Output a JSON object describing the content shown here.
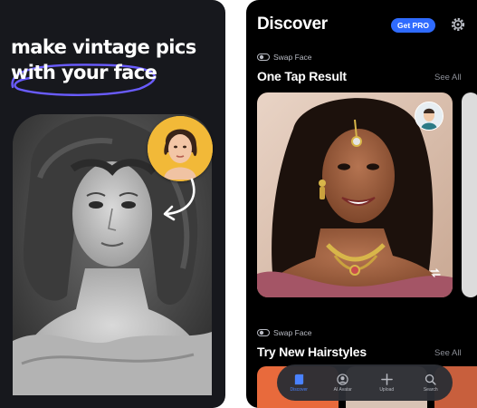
{
  "promo": {
    "headline_line1": "make vintage pics",
    "headline_line2": "with your face",
    "accent_color": "#6a5cff",
    "photo_style": "black-and-white vintage portrait",
    "face_bubble_color": "#f2b938",
    "icons": [
      "face-swap-arrow-icon"
    ]
  },
  "app": {
    "title": "Discover",
    "pro_badge": "Get PRO",
    "settings_icon": "gear-icon",
    "accent_color": "#2f6bff",
    "sections": [
      {
        "kicker": "Swap Face",
        "kicker_icon": "swap-face-icon",
        "title": "One Tap Result",
        "see_all": "See All"
      },
      {
        "kicker": "Swap Face",
        "kicker_icon": "swap-face-icon",
        "title": "Try New Hairstyles",
        "see_all": "See All"
      }
    ],
    "tabs": [
      {
        "label": "Discover",
        "icon": "discover-icon",
        "active": true
      },
      {
        "label": "AI Avatar",
        "icon": "avatar-icon",
        "active": false
      },
      {
        "label": "Upload",
        "icon": "plus-icon",
        "active": false
      },
      {
        "label": "Search",
        "icon": "search-icon",
        "active": false
      }
    ]
  }
}
